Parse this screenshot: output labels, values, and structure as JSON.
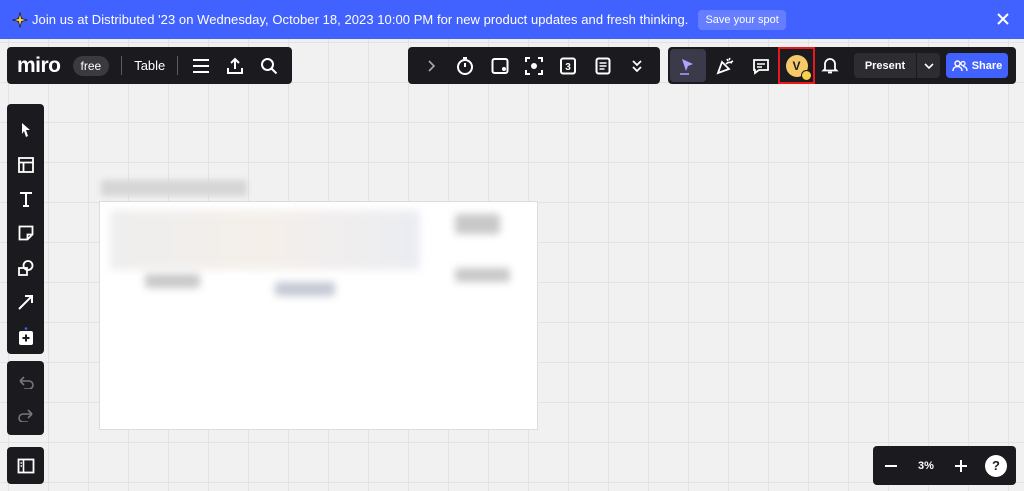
{
  "banner": {
    "icon": "sparkle-icon",
    "text": "Join us at Distributed '23 on Wednesday, October 18, 2023 10:00 PM for new product updates and fresh thinking.",
    "cta_label": "Save your spot",
    "close_icon": "close-icon",
    "color": "#4262ff"
  },
  "top_left": {
    "logo": "miro",
    "plan": "free",
    "board_name": "Table",
    "icons": [
      "menu-icon",
      "upload-icon",
      "search-icon"
    ]
  },
  "center_toolbar": {
    "icons": [
      "chevron-right-icon",
      "timer-icon",
      "card-icon",
      "focus-icon",
      "counter-icon",
      "notes-icon",
      "chevron-double-down-icon"
    ],
    "counter_value": "3"
  },
  "right_toolbar": {
    "avatar_initial": "V",
    "present_label": "Present",
    "share_label": "Share",
    "share_color": "#4262ff"
  },
  "left_tools": {
    "tools": [
      "select-icon",
      "templates-icon",
      "text-icon",
      "sticky-note-icon",
      "shapes-icon",
      "arrow-icon",
      "add-more-icon"
    ]
  },
  "zoom": {
    "level": "3%",
    "minus_icon": "zoom-out-icon",
    "plus_icon": "zoom-in-icon",
    "help_label": "?"
  }
}
